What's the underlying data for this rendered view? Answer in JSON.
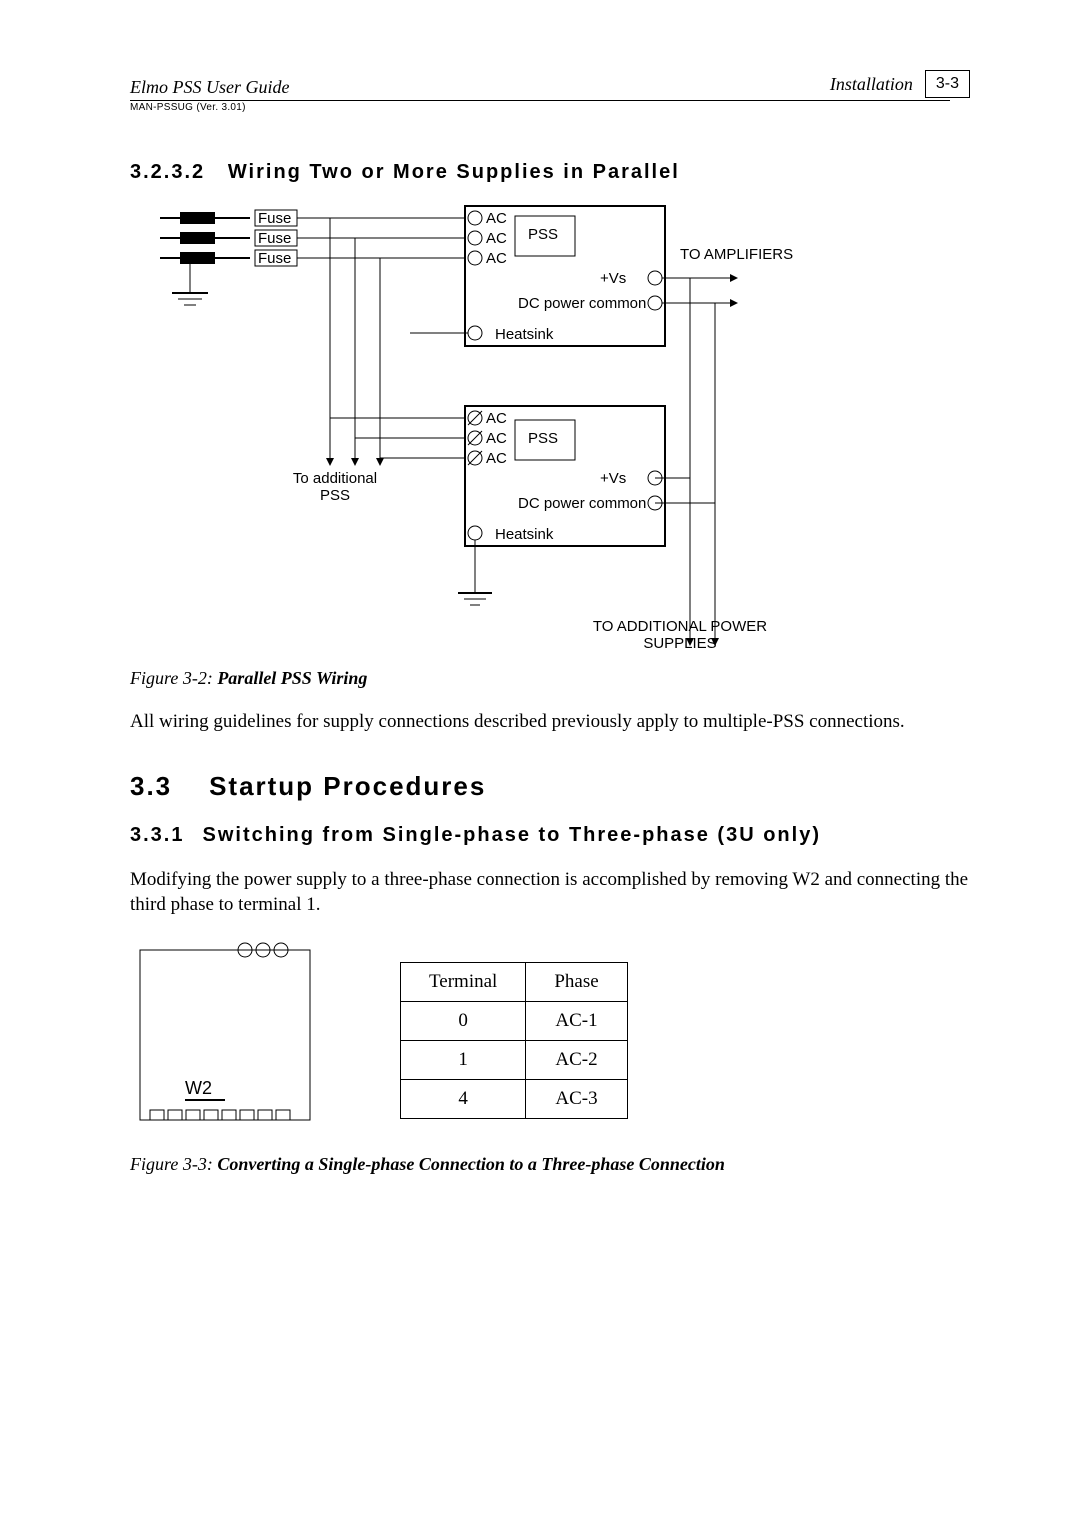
{
  "header": {
    "guide_title": "Elmo PSS User Guide",
    "section_name": "Installation",
    "page_number": "3-3",
    "doc_ref": "MAN-PSSUG (Ver. 3.01)"
  },
  "section_3_2_3_2": {
    "number": "3.2.3.2",
    "title": "Wiring Two or More Supplies in Parallel"
  },
  "figure_3_2": {
    "labels": {
      "fuse1": "Fuse",
      "fuse2": "Fuse",
      "fuse3": "Fuse",
      "ac": "AC",
      "pss": "PSS",
      "to_amplifiers": "TO AMPLIFIERS",
      "vs": "+Vs",
      "dc_common": "DC power common",
      "heatsink": "Heatsink",
      "to_additional_pss": "To additional PSS",
      "to_additional_supplies": "TO ADDITIONAL POWER SUPPLIES"
    },
    "caption_prefix": "Figure 3-2: ",
    "caption_bold": "Parallel PSS Wiring"
  },
  "paragraph_1": "All wiring guidelines for supply connections described previously apply to multiple-PSS connections.",
  "section_3_3": {
    "number": "3.3",
    "title": "Startup Procedures"
  },
  "section_3_3_1": {
    "number": "3.3.1",
    "title": "Switching from Single-phase to Three-phase (3U only)"
  },
  "paragraph_2": "Modifying the power supply to a three-phase connection is accomplished by removing W2 and connecting the third phase to terminal 1.",
  "w2_label": "W2",
  "terminal_table": {
    "headers": [
      "Terminal",
      "Phase"
    ],
    "rows": [
      [
        "0",
        "AC-1"
      ],
      [
        "1",
        "AC-2"
      ],
      [
        "4",
        "AC-3"
      ]
    ]
  },
  "figure_3_3": {
    "caption_prefix": "Figure 3-3: ",
    "caption_bold": "Converting a Single-phase Connection to a Three-phase Connection"
  }
}
